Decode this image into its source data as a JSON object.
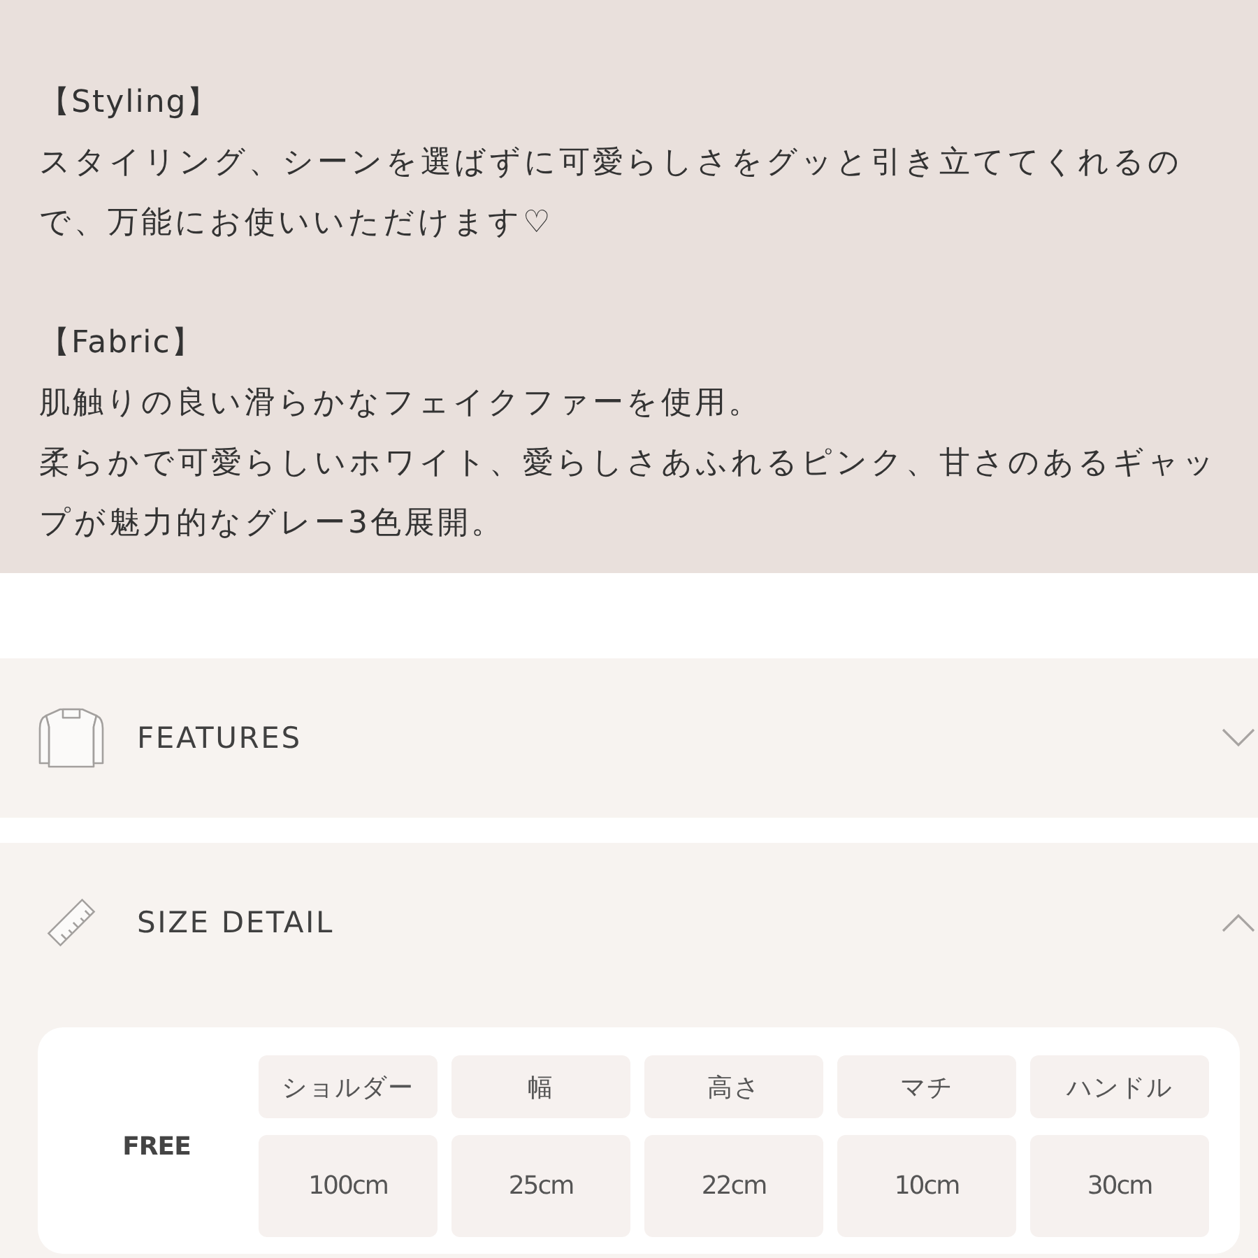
{
  "description": {
    "sections": [
      {
        "heading": "【Styling】",
        "paragraphs": [
          "スタイリング、シーンを選ばずに可愛らしさをグッと引き立ててくれるので、万能にお使いいただけます♡"
        ]
      },
      {
        "heading": "【Fabric】",
        "paragraphs": [
          "肌触りの良い滑らかなフェイクファーを使用。",
          "柔らかで可愛らしいホワイト、愛らしさあふれるピンク、甘さのあるギャップが魅力的なグレー3色展開。"
        ]
      }
    ]
  },
  "features": {
    "title": "FEATURES",
    "expanded": false
  },
  "size_detail": {
    "title": "SIZE DETAIL",
    "expanded": true,
    "table": {
      "columns": [
        "ショルダー",
        "幅",
        "高さ",
        "マチ",
        "ハンドル"
      ],
      "rows": [
        {
          "size": "FREE",
          "values": [
            "100cm",
            "25cm",
            "22cm",
            "10cm",
            "30cm"
          ]
        }
      ]
    }
  }
}
